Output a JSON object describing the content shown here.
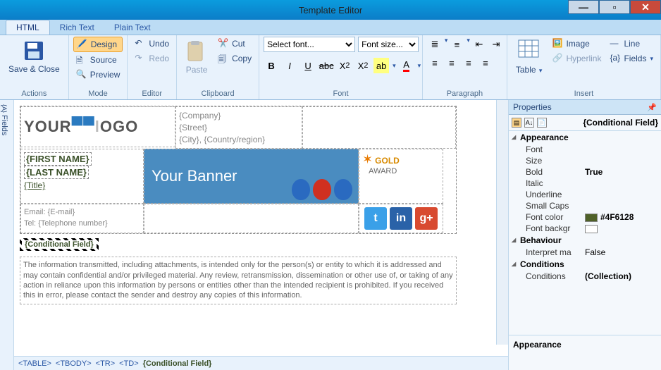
{
  "window": {
    "title": "Template Editor"
  },
  "tabs": {
    "html": "HTML",
    "rich": "Rich Text",
    "plain": "Plain Text"
  },
  "ribbon": {
    "actions": {
      "label": "Actions",
      "save": "Save & Close"
    },
    "mode": {
      "label": "Mode",
      "design": "Design",
      "source": "Source",
      "preview": "Preview"
    },
    "editor": {
      "label": "Editor",
      "undo": "Undo",
      "redo": "Redo"
    },
    "clipboard": {
      "label": "Clipboard",
      "paste": "Paste",
      "cut": "Cut",
      "copy": "Copy"
    },
    "font": {
      "label": "Font",
      "select_font": "Select font...",
      "font_size": "Font size..."
    },
    "paragraph": {
      "label": "Paragraph"
    },
    "insert": {
      "label": "Insert",
      "table": "Table",
      "image": "Image",
      "line": "Line",
      "hyperlink": "Hyperlink",
      "fields": "Fields"
    }
  },
  "left_rail": "Fields",
  "template": {
    "logo_your": "YOUR",
    "logo_logo": "OGO",
    "company": "{Company}",
    "street": "{Street}",
    "city": "{City}",
    "country": "{Country/region}",
    "first_name": "{FIRST NAME}",
    "last_name": "{LAST NAME}",
    "title": "{Title}",
    "banner": "Your Banner",
    "award_gold": "GOLD",
    "award_text": "AWARD",
    "email_lbl": "Email:",
    "email_val": "{E-mail}",
    "tel_lbl": "Tel:",
    "tel_val": "{Telephone number}",
    "cond": "{Conditional Field}",
    "disclaimer": "The information transmitted, including attachments, is intended only for the person(s) or entity to which it is addressed and may contain confidential and/or privileged material.  Any review, retransmission, dissemination or other use of, or taking of any action in reliance upon this information by persons or entities other than the intended recipient is prohibited.  If you received this in error, please contact the sender and destroy any copies of this information."
  },
  "status": {
    "table": "<TABLE>",
    "tbody": "<TBODY>",
    "tr": "<TR>",
    "td": "<TD>",
    "sel": "{Conditional Field}"
  },
  "props": {
    "header": "Properties",
    "selected": "{Conditional Field}",
    "cat_appearance": "Appearance",
    "font": "Font",
    "size": "Size",
    "bold": "Bold",
    "bold_val": "True",
    "italic": "Italic",
    "underline": "Underline",
    "smallcaps": "Small Caps",
    "fontcolor": "Font color",
    "fontcolor_val": "#4F6128",
    "fontbg": "Font backgr",
    "cat_behaviour": "Behaviour",
    "interpret": "Interpret ma",
    "interpret_val": "False",
    "cat_conditions": "Conditions",
    "conditions": "Conditions",
    "conditions_val": "(Collection)",
    "desc": "Appearance"
  }
}
